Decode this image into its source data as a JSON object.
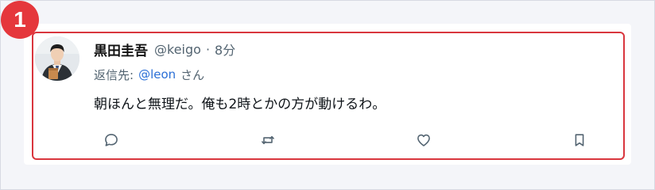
{
  "step_number": "1",
  "post": {
    "author_name": "黒田圭吾",
    "handle": "@keigo",
    "separator": "·",
    "time": "8分",
    "reply_prefix": "返信先:",
    "reply_mention": "@leon",
    "reply_suffix": "さん",
    "text": "朝ほんと無理だ。俺も2時とかの方が動けるわ。"
  },
  "actions": [
    "reply-icon",
    "repost-icon",
    "like-icon",
    "bookmark-icon"
  ],
  "colors": {
    "highlight_border": "#d9363e",
    "badge": "#e5373c",
    "mention": "#2b6fd6",
    "muted_text": "#536471"
  }
}
